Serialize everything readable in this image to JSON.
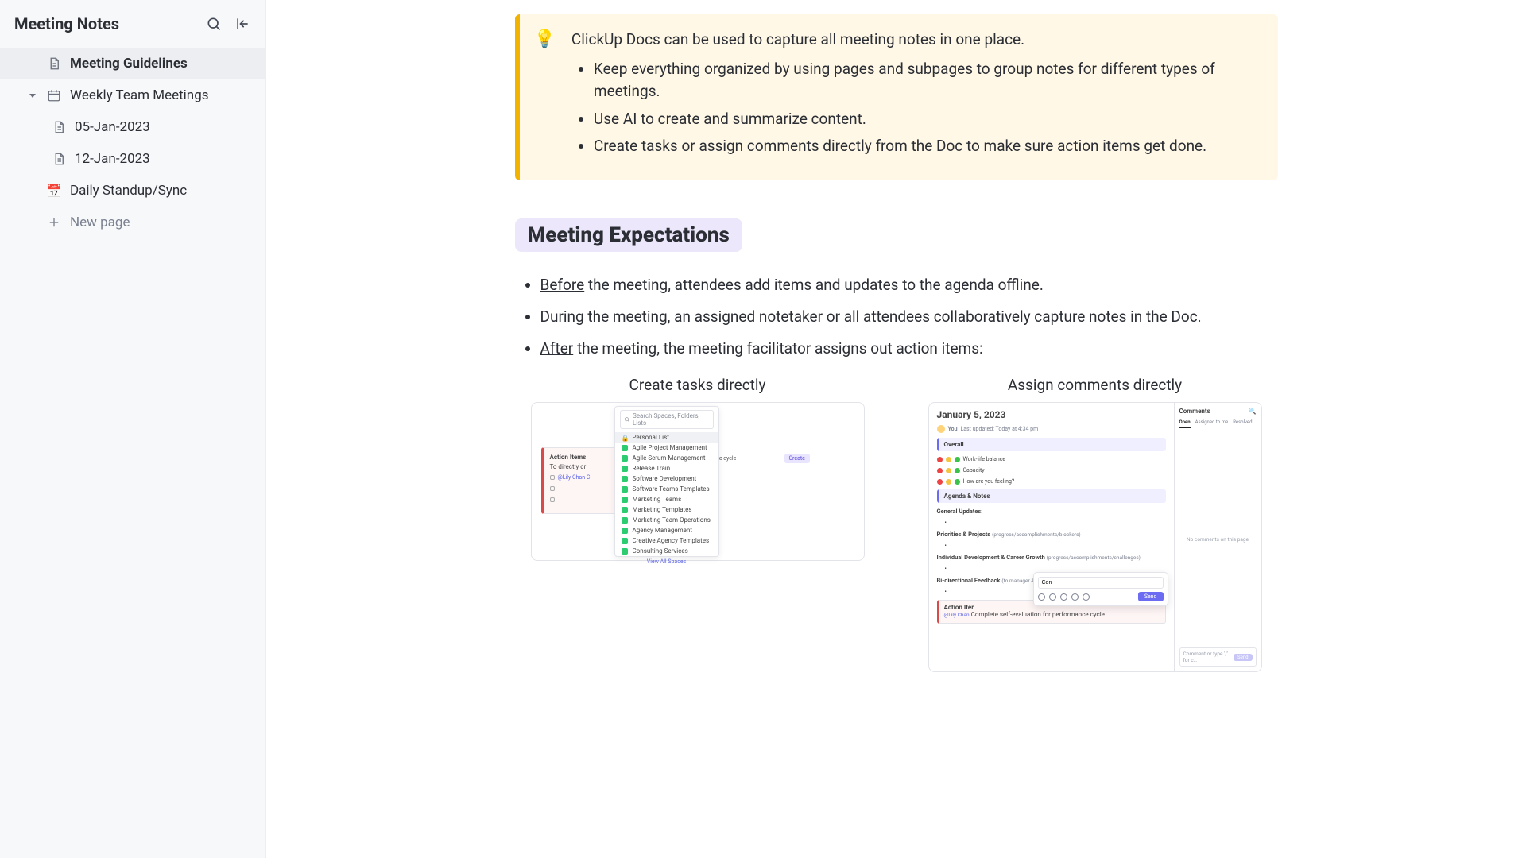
{
  "sidebar": {
    "title": "Meeting Notes",
    "items": [
      {
        "label": "Meeting Guidelines",
        "type": "doc",
        "depth": 1,
        "selected": true
      },
      {
        "label": "Weekly Team Meetings",
        "type": "folder",
        "depth": 1,
        "expanded": true
      },
      {
        "label": "05-Jan-2023",
        "type": "doc",
        "depth": 2
      },
      {
        "label": "12-Jan-2023",
        "type": "doc",
        "depth": 2
      },
      {
        "label": "Daily Standup/Sync",
        "type": "emoji",
        "emoji": "📅",
        "depth": 1
      }
    ],
    "new_page": "New page"
  },
  "callout": {
    "emoji": "💡",
    "lead": "ClickUp Docs can be used to capture all meeting notes in one place.",
    "bullets": [
      "Keep everything organized by using pages and subpages to group notes for different types of meetings.",
      "Use AI to create and summarize content.",
      "Create tasks or assign comments directly from the Doc to make sure action items get done."
    ]
  },
  "expectations": {
    "heading": "Meeting Expectations",
    "items": [
      {
        "u": "Before",
        "rest": " the meeting, attendees add items and updates to the agenda offline."
      },
      {
        "u": "During",
        "rest": " the meeting, an assigned notetaker or all attendees collaboratively capture notes in the Doc."
      },
      {
        "u": "After",
        "rest": " the meeting, the meeting facilitator assigns out action items:"
      }
    ]
  },
  "columns": {
    "left": {
      "title": "Create tasks directly",
      "search_ph": "Search Spaces, Folders, Lists",
      "panel_selected": "Personal List",
      "panel_items": [
        {
          "label": "Agile Project Management",
          "color": "sc-blue"
        },
        {
          "label": "Agile Scrum Management",
          "color": "sc-blue"
        },
        {
          "label": "Release Train",
          "color": "sc-teal"
        },
        {
          "label": "Software Development",
          "color": "sc-teal"
        },
        {
          "label": "Software Teams Templates",
          "color": "sc-blue"
        },
        {
          "label": "Marketing Teams",
          "color": "sc-purple"
        },
        {
          "label": "Marketing Templates",
          "color": "sc-purple"
        },
        {
          "label": "Marketing Team Operations",
          "color": "sc-purple"
        },
        {
          "label": "Agency Management",
          "color": "sc-orange"
        },
        {
          "label": "Creative Agency Templates",
          "color": "sc-orange"
        },
        {
          "label": "Consulting Services",
          "color": "sc-grey"
        }
      ],
      "panel_footer": "View All Spaces",
      "card_title": "Action Items",
      "card_sub": "To directly cr",
      "card_names": "@Lily Chan C",
      "rtext": "performance cycle",
      "pill": "Create",
      "rtext2": "cycle"
    },
    "right": {
      "title": "Assign comments directly",
      "doc_title": "January 5, 2023",
      "meta_name": "You",
      "meta_time": "Last updated: Today at 4:34 pm",
      "sec_overall": "Overall",
      "rows": [
        "Work-life balance",
        "Capacity",
        "How are you feeling?"
      ],
      "sec_agenda": "Agenda & Notes",
      "subsections": [
        {
          "t": "General Updates:",
          "n": ""
        },
        {
          "t": "Priorities & Projects",
          "n": "(progress/accomplishments/blockers)"
        },
        {
          "t": "Individual Development & Career Growth",
          "n": "(progress/accomplishments/challenges)"
        },
        {
          "t": "Bi-directional Feedback",
          "n": "(to manager & to employee)"
        }
      ],
      "ai_title": "Action Iter",
      "ai_names": "@Lily Chan",
      "ai_line": "Complete self-evaluation for performance cycle",
      "popup_input": "Con",
      "popup_send": "Send",
      "side_header": "Comments",
      "side_tabs": [
        "Open",
        "Assigned to me",
        "Resolved"
      ],
      "side_empty": "No comments on this page",
      "side_footer": "Comment or type '/' for c…",
      "side_send": "Send"
    }
  }
}
